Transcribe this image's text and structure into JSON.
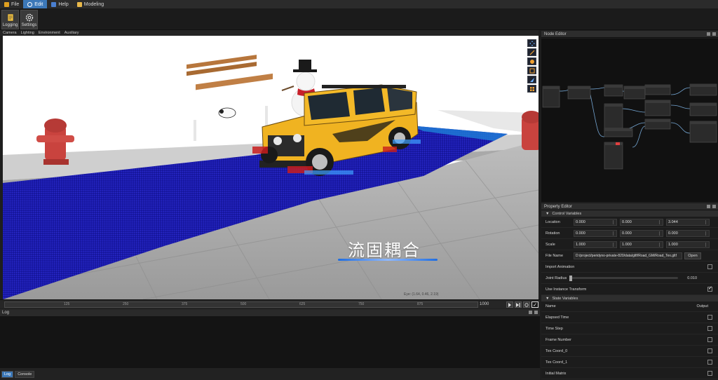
{
  "menu": {
    "items": [
      {
        "label": "File",
        "icon": "app-icon",
        "active": false
      },
      {
        "label": "Edit",
        "icon": "gear-icon",
        "active": true
      },
      {
        "label": "Help",
        "icon": "help-icon",
        "active": false
      },
      {
        "label": "Modeling",
        "icon": "folder-icon",
        "active": false
      }
    ]
  },
  "toolbar": {
    "logging_label": "Logging",
    "settings_label": "Settings"
  },
  "viewport": {
    "tabs": [
      "Camera",
      "Lighting",
      "Environment",
      "Auxiliary"
    ],
    "caption": "流固耦合",
    "coord_text": "Eye: (1.64, 0.46, 2.19)"
  },
  "timeline": {
    "ticks": [
      "125",
      "250",
      "375",
      "500",
      "625",
      "750",
      "875"
    ],
    "end_value": "1000"
  },
  "log": {
    "title": "Log",
    "tabs": [
      {
        "label": "Log",
        "active": true
      },
      {
        "label": "Console",
        "active": false
      }
    ]
  },
  "node_editor": {
    "title": "Node Editor"
  },
  "property_editor": {
    "title": "Property Editor",
    "control_section": "Control Variables",
    "location": {
      "label": "Location",
      "values": [
        "0.000",
        "0.000",
        "3.044"
      ]
    },
    "rotation": {
      "label": "Rotation",
      "values": [
        "0.000",
        "0.000",
        "0.000"
      ]
    },
    "scale": {
      "label": "Scale",
      "values": [
        "1.000",
        "1.000",
        "1.000"
      ]
    },
    "file_name": {
      "label": "File Name",
      "value": "D:/project/peridyno-private-820/data/gltf/Road_GM/Road_Tex.gltf",
      "button": "Open"
    },
    "import_animation": {
      "label": "Import Animation",
      "checked": false
    },
    "joint_radius": {
      "label": "Joint Radius",
      "value": "0.010",
      "fraction": 0.0
    },
    "use_instance_transform": {
      "label": "Use Instance Transform",
      "checked": true
    },
    "state_section": "State Variables",
    "state_header": {
      "name": "Name",
      "output": "Output"
    },
    "state_items": [
      "Elapsed Time",
      "Time Step",
      "Frame Number",
      "Tex Coord_0",
      "Tex Coord_1",
      "Initial Matrix"
    ]
  },
  "colors": {
    "accent": "#3c78b8",
    "water": "#1a1aa6",
    "road": "#a8a8a8",
    "car": "#f0b321"
  }
}
